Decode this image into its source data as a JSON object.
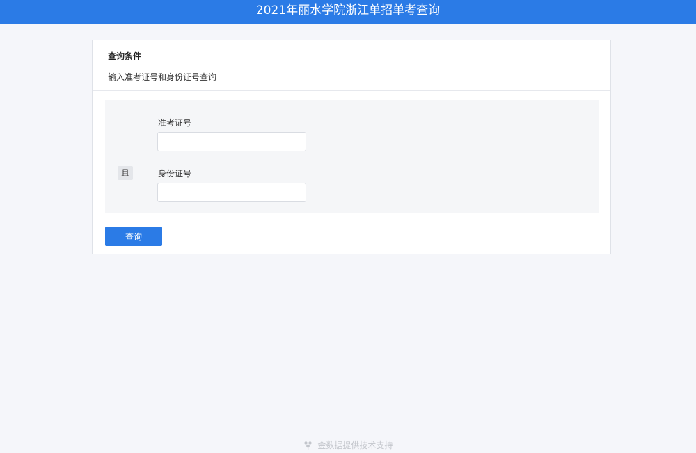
{
  "header": {
    "title": "2021年丽水学院浙江单招单考查询"
  },
  "query_card": {
    "title": "查询条件",
    "description": "输入准考证号和身份证号查询",
    "and_label": "且",
    "fields": [
      {
        "label": "准考证号",
        "value": "",
        "placeholder": ""
      },
      {
        "label": "身份证号",
        "value": "",
        "placeholder": ""
      }
    ],
    "submit_label": "查询"
  },
  "footer": {
    "text": "金数据提供技术支持",
    "icon": "jinshuju-logo-icon"
  },
  "colors": {
    "accent": "#2b7be6",
    "background": "#f5f6fa",
    "panel": "#f5f6f8"
  }
}
